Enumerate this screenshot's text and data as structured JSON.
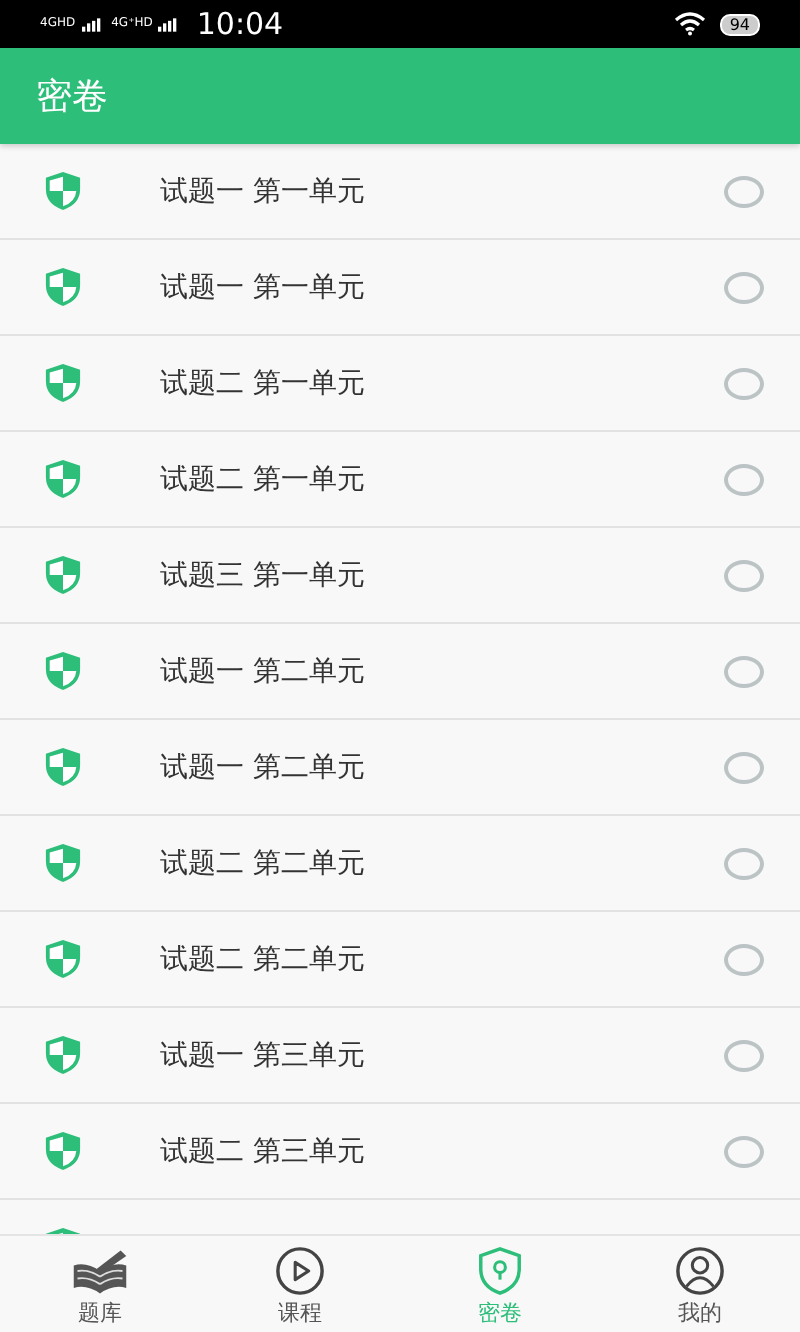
{
  "status_bar": {
    "network_1": "4GHD",
    "network_2": "4G⁺HD",
    "time": "10:04",
    "battery": "94"
  },
  "header": {
    "title": "密卷"
  },
  "rows": [
    {
      "title": "试题一 第一单元",
      "selected": false
    },
    {
      "title": "试题一 第一单元",
      "selected": false
    },
    {
      "title": "试题二 第一单元",
      "selected": false
    },
    {
      "title": "试题二 第一单元",
      "selected": false
    },
    {
      "title": "试题三 第一单元",
      "selected": false
    },
    {
      "title": "试题一 第二单元",
      "selected": false
    },
    {
      "title": "试题一 第二单元",
      "selected": false
    },
    {
      "title": "试题二 第二单元",
      "selected": false
    },
    {
      "title": "试题二 第二单元",
      "selected": false
    },
    {
      "title": "试题一 第三单元",
      "selected": false
    },
    {
      "title": "试题二 第三单元",
      "selected": false
    }
  ],
  "bottom_nav": [
    {
      "kind": "book",
      "label": "题库",
      "selected": false
    },
    {
      "kind": "play",
      "label": "课程",
      "selected": false
    },
    {
      "kind": "shield",
      "label": "密卷",
      "selected": true
    },
    {
      "kind": "person",
      "label": "我的",
      "selected": false
    }
  ]
}
